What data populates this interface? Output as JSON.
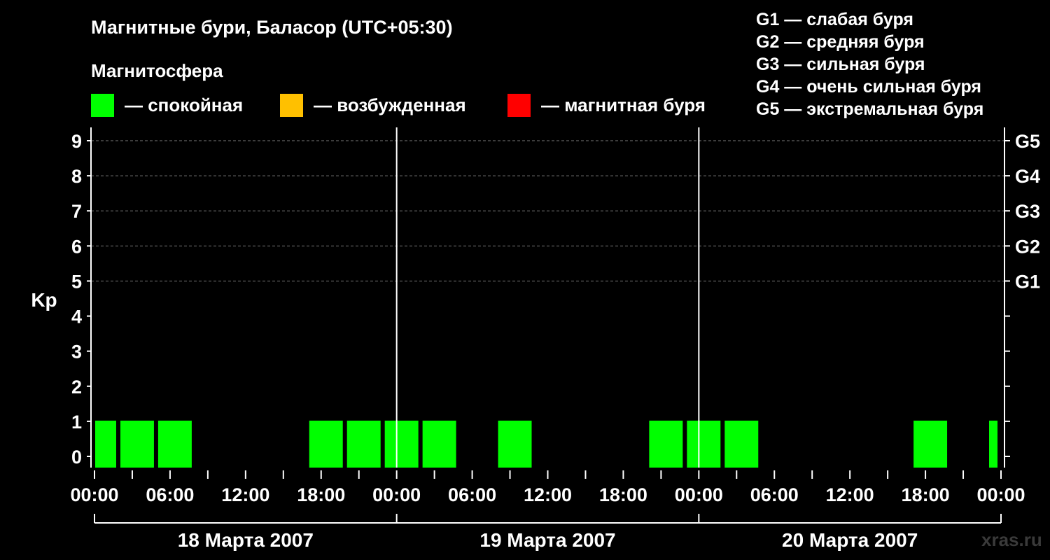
{
  "header": {
    "title": "Магнитные бури, Баласор (UTC+05:30)",
    "subtitle": "Магнитосфера"
  },
  "legend": [
    {
      "label": "— спокойная",
      "color": "#00ff00"
    },
    {
      "label": "— возбужденная",
      "color": "#ffc000"
    },
    {
      "label": "— магнитная буря",
      "color": "#ff0000"
    }
  ],
  "g_scale": [
    "G1 — слабая буря",
    "G2 — средняя буря",
    "G3 — сильная буря",
    "G4 — очень сильная буря",
    "G5 — экстремальная буря"
  ],
  "credit": "xras.ru",
  "chart_data": {
    "type": "bar",
    "ylabel": "Kp",
    "ylim": [
      0,
      9
    ],
    "yticks": [
      0,
      1,
      2,
      3,
      4,
      5,
      6,
      7,
      8,
      9
    ],
    "right_axis": [
      {
        "kp": 5,
        "label": "G1"
      },
      {
        "kp": 6,
        "label": "G2"
      },
      {
        "kp": 7,
        "label": "G3"
      },
      {
        "kp": 8,
        "label": "G4"
      },
      {
        "kp": 9,
        "label": "G5"
      }
    ],
    "grid": "dashed horizontal at Kp 5–9",
    "x_tick_labels": [
      "00:00",
      "06:00",
      "12:00",
      "18:00",
      "00:00",
      "06:00",
      "12:00",
      "18:00",
      "00:00",
      "06:00",
      "12:00",
      "18:00",
      "00:00"
    ],
    "days": [
      "18 Марта 2007",
      "19 Марта 2007",
      "20 Марта 2007"
    ],
    "x_unit": "hours from 18 Марта 2007 00:00 (UTC+05:30)",
    "xlim": [
      0,
      72
    ],
    "colors": {
      "quiet": "#00ff00",
      "active": "#ffc000",
      "storm": "#ff0000"
    },
    "bars": [
      {
        "start": 0,
        "end": 2,
        "kp": 1,
        "level": "quiet"
      },
      {
        "start": 2,
        "end": 5,
        "kp": 1,
        "level": "quiet"
      },
      {
        "start": 5,
        "end": 8,
        "kp": 1,
        "level": "quiet"
      },
      {
        "start": 17,
        "end": 20,
        "kp": 1,
        "level": "quiet"
      },
      {
        "start": 20,
        "end": 23,
        "kp": 1,
        "level": "quiet"
      },
      {
        "start": 23,
        "end": 26,
        "kp": 1,
        "level": "quiet"
      },
      {
        "start": 26,
        "end": 29,
        "kp": 1,
        "level": "quiet"
      },
      {
        "start": 32,
        "end": 35,
        "kp": 1,
        "level": "quiet"
      },
      {
        "start": 44,
        "end": 47,
        "kp": 1,
        "level": "quiet"
      },
      {
        "start": 47,
        "end": 50,
        "kp": 1,
        "level": "quiet"
      },
      {
        "start": 50,
        "end": 53,
        "kp": 1,
        "level": "quiet"
      },
      {
        "start": 65,
        "end": 68,
        "kp": 1,
        "level": "quiet"
      },
      {
        "start": 71,
        "end": 72,
        "kp": 1,
        "level": "quiet"
      }
    ]
  }
}
